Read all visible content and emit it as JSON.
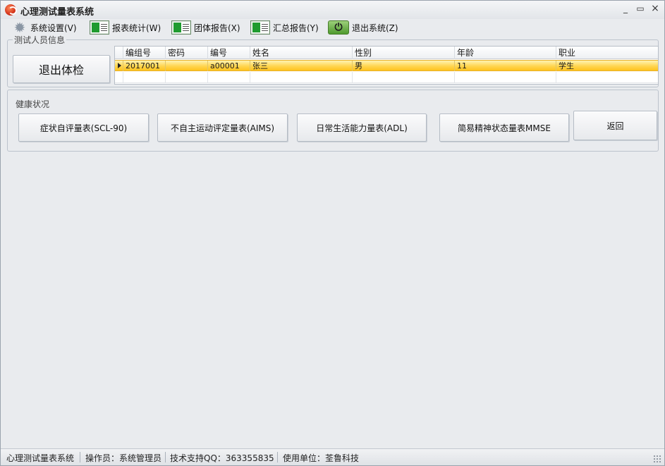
{
  "window": {
    "title": "心理测试量表系统"
  },
  "menu": [
    {
      "label": "系统设置(V)",
      "icon": "gear-icon"
    },
    {
      "label": "报表统计(W)",
      "icon": "sheet-icon"
    },
    {
      "label": "团体报告(X)",
      "icon": "sheet-icon"
    },
    {
      "label": "汇总报告(Y)",
      "icon": "sheet-icon"
    },
    {
      "label": "退出系统(Z)",
      "icon": "power-icon"
    }
  ],
  "person_group": {
    "label": "测试人员信息",
    "exit_button": "退出体检"
  },
  "grid": {
    "columns": [
      "编组号",
      "密码",
      "编号",
      "姓名",
      "性别",
      "年龄",
      "职业"
    ],
    "rows": [
      [
        "2017001",
        "",
        "a00001",
        "张三",
        "男",
        "11",
        "学生"
      ]
    ]
  },
  "health_group": {
    "label": "健康状况",
    "buttons": [
      "症状自评量表(SCL-90)",
      "不自主运动评定量表(AIMS)",
      "日常生活能力量表(ADL)",
      "简易精神状态量表MMSE",
      "返回"
    ]
  },
  "status": {
    "app": "心理测试量表系统",
    "operator": "操作员：系统管理员",
    "support": "技术支持QQ：363355835",
    "unit": "使用单位：荃鲁科技"
  },
  "colors": {
    "selection": "#ffd34a",
    "background": "#e9ebee",
    "icon_green": "#1f9b2f"
  }
}
